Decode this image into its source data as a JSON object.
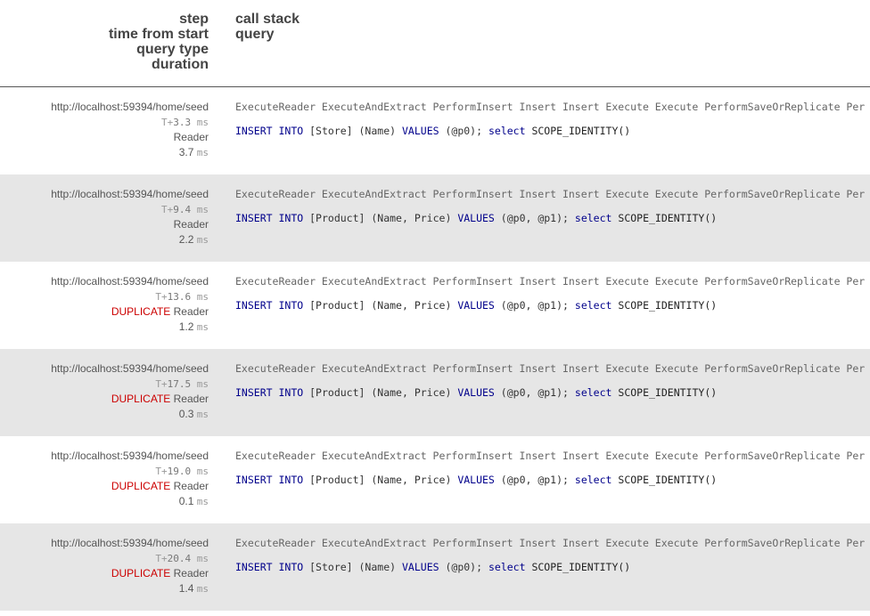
{
  "header": {
    "left": [
      "step",
      "time from start",
      "query type",
      "duration"
    ],
    "right": [
      "call stack",
      "query"
    ]
  },
  "colors": {
    "duplicate": "#cc0000",
    "keyword": "#00008b",
    "alt_row": "#e6e6e6"
  },
  "stack_text": "ExecuteReader ExecuteAndExtract PerformInsert Insert Insert Execute Execute PerformSaveOrReplicate Per",
  "rows": [
    {
      "url": "http://localhost:59394/home/seed",
      "t_prefix": "T+",
      "t": "3.3",
      "t_unit": "ms",
      "duplicate": "",
      "type": "Reader",
      "duration": "3.7",
      "d_unit": "ms",
      "q": [
        "INSERT",
        "INTO",
        "[Store] (Name)",
        "VALUES",
        "(@p0);",
        "select",
        "SCOPE_IDENTITY()"
      ]
    },
    {
      "url": "http://localhost:59394/home/seed",
      "t_prefix": "T+",
      "t": "9.4",
      "t_unit": "ms",
      "duplicate": "",
      "type": "Reader",
      "duration": "2.2",
      "d_unit": "ms",
      "q": [
        "INSERT",
        "INTO",
        "[Product] (Name, Price)",
        "VALUES",
        "(@p0, @p1);",
        "select",
        "SCOPE_IDENTITY()"
      ]
    },
    {
      "url": "http://localhost:59394/home/seed",
      "t_prefix": "T+",
      "t": "13.6",
      "t_unit": "ms",
      "duplicate": "DUPLICATE",
      "type": "Reader",
      "duration": "1.2",
      "d_unit": "ms",
      "q": [
        "INSERT",
        "INTO",
        "[Product] (Name, Price)",
        "VALUES",
        "(@p0, @p1);",
        "select",
        "SCOPE_IDENTITY()"
      ]
    },
    {
      "url": "http://localhost:59394/home/seed",
      "t_prefix": "T+",
      "t": "17.5",
      "t_unit": "ms",
      "duplicate": "DUPLICATE",
      "type": "Reader",
      "duration": "0.3",
      "d_unit": "ms",
      "q": [
        "INSERT",
        "INTO",
        "[Product] (Name, Price)",
        "VALUES",
        "(@p0, @p1);",
        "select",
        "SCOPE_IDENTITY()"
      ]
    },
    {
      "url": "http://localhost:59394/home/seed",
      "t_prefix": "T+",
      "t": "19.0",
      "t_unit": "ms",
      "duplicate": "DUPLICATE",
      "type": "Reader",
      "duration": "0.1",
      "d_unit": "ms",
      "q": [
        "INSERT",
        "INTO",
        "[Product] (Name, Price)",
        "VALUES",
        "(@p0, @p1);",
        "select",
        "SCOPE_IDENTITY()"
      ]
    },
    {
      "url": "http://localhost:59394/home/seed",
      "t_prefix": "T+",
      "t": "20.4",
      "t_unit": "ms",
      "duplicate": "DUPLICATE",
      "type": "Reader",
      "duration": "1.4",
      "d_unit": "ms",
      "q": [
        "INSERT",
        "INTO",
        "[Store] (Name)",
        "VALUES",
        "(@p0);",
        "select",
        "SCOPE_IDENTITY()"
      ]
    }
  ]
}
